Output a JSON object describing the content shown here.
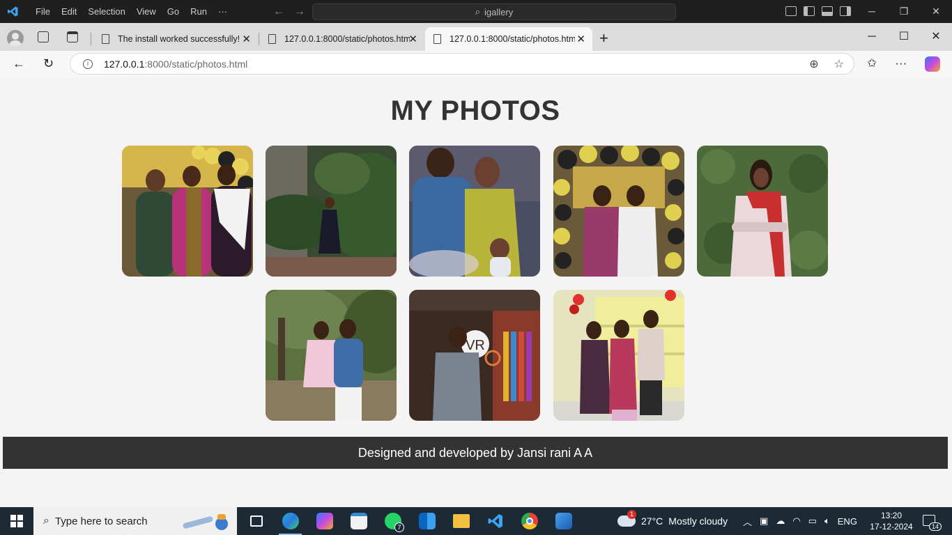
{
  "vscode": {
    "menu": [
      "File",
      "Edit",
      "Selection",
      "View",
      "Go",
      "Run",
      "···"
    ],
    "search_text": "igallery"
  },
  "browser": {
    "tabs": [
      {
        "title": "The install worked successfully! Co",
        "active": false
      },
      {
        "title": "127.0.0.1:8000/static/photos.html",
        "active": false
      },
      {
        "title": "127.0.0.1:8000/static/photos.html",
        "active": true
      }
    ],
    "url_host": "127.0.0.1",
    "url_path": ":8000/static/photos.html"
  },
  "page": {
    "title": "MY PHOTOS",
    "photos": [
      {
        "icon": "photo-family-saree-balloons"
      },
      {
        "icon": "photo-woman-garden"
      },
      {
        "icon": "photo-couple-child"
      },
      {
        "icon": "photo-two-women-balloons"
      },
      {
        "icon": "photo-woman-ivy-wall"
      },
      {
        "icon": "photo-man-holding-girl"
      },
      {
        "icon": "photo-man-cinema"
      },
      {
        "icon": "photo-three-friends-party"
      }
    ],
    "footer": "Designed and developed by Jansi rani A A"
  },
  "taskbar": {
    "search_placeholder": "Type here to search",
    "whatsapp_badge": "7",
    "weather_alert": "1",
    "temperature": "27°C",
    "weather": "Mostly cloudy",
    "language": "ENG",
    "time": "13:20",
    "date": "17-12-2024",
    "notifications": "14"
  }
}
